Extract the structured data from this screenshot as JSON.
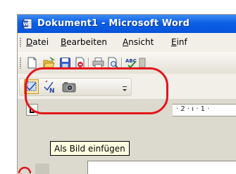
{
  "window": {
    "title": "Dokument1 - Microsoft Word"
  },
  "menubar": {
    "items": [
      {
        "label": "Datei",
        "accel": "D",
        "rest": "atei"
      },
      {
        "label": "Bearbeiten",
        "accel": "B",
        "rest": "earbeiten"
      },
      {
        "label": "Ansicht",
        "accel": "A",
        "rest": "nsicht"
      },
      {
        "label": "Einf",
        "accel": "E",
        "rest": "inf"
      }
    ]
  },
  "standard_toolbar": {
    "icons": [
      "new-document-icon",
      "open-folder-icon",
      "save-icon",
      "permission-icon",
      "print-icon",
      "print-preview-icon",
      "spelling-icon"
    ]
  },
  "picture_toolbar": {
    "icons": [
      "insert-as-picture-icon",
      "insert-as-text-icon",
      "camera-icon",
      "toolbar-options-icon"
    ]
  },
  "ruler": {
    "marks": "· 2 · ı · 1 ·"
  },
  "tooltip": {
    "text": "Als Bild einfügen"
  },
  "colors": {
    "titlebar": "#0c5fe6",
    "highlight_ring": "#e3151b",
    "tooltip_bg": "#ffffe1",
    "active_button": "#fbe6a8"
  }
}
